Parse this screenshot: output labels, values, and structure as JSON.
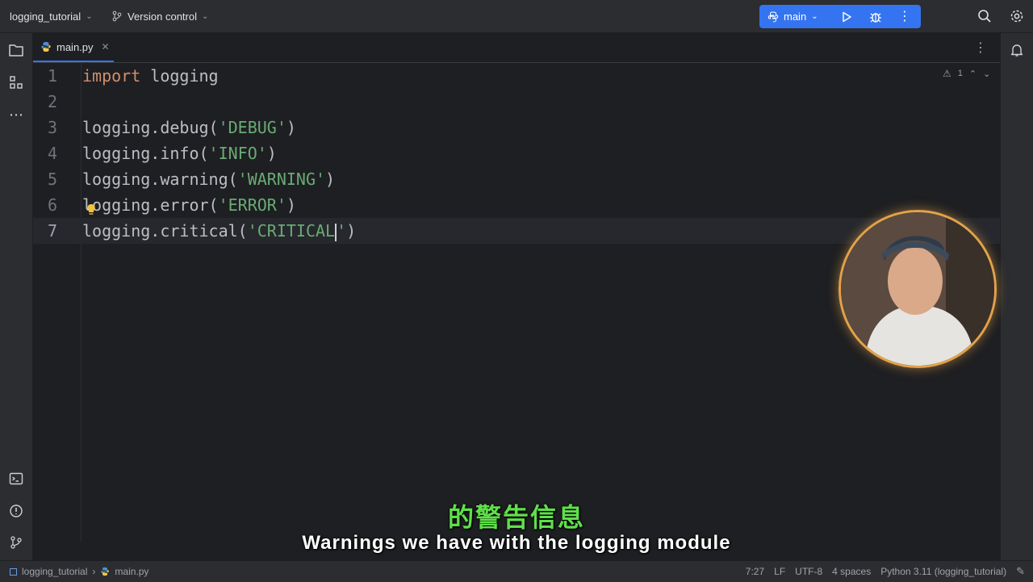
{
  "titlebar": {
    "project_name": "logging_tutorial",
    "vcs_label": "Version control",
    "run_config": "main"
  },
  "tabs": [
    {
      "label": "main.py",
      "active": true
    }
  ],
  "editor": {
    "lines": [
      {
        "num": "1",
        "tokens": [
          {
            "t": "import",
            "c": "kw"
          },
          {
            "t": " logging",
            "c": ""
          }
        ]
      },
      {
        "num": "2",
        "tokens": []
      },
      {
        "num": "3",
        "tokens": [
          {
            "t": "logging.debug(",
            "c": ""
          },
          {
            "t": "'DEBUG'",
            "c": "str"
          },
          {
            "t": ")",
            "c": ""
          }
        ]
      },
      {
        "num": "4",
        "tokens": [
          {
            "t": "logging.info(",
            "c": ""
          },
          {
            "t": "'INFO'",
            "c": "str"
          },
          {
            "t": ")",
            "c": ""
          }
        ]
      },
      {
        "num": "5",
        "tokens": [
          {
            "t": "logging.warning(",
            "c": ""
          },
          {
            "t": "'WARNING'",
            "c": "str"
          },
          {
            "t": ")",
            "c": ""
          }
        ]
      },
      {
        "num": "6",
        "tokens": [
          {
            "t": "logging.error(",
            "c": ""
          },
          {
            "t": "'ERROR'",
            "c": "str"
          },
          {
            "t": ")",
            "c": ""
          }
        ]
      },
      {
        "num": "7",
        "tokens": [
          {
            "t": "logging.critical(",
            "c": ""
          },
          {
            "t": "'CRITICAL",
            "c": "str"
          },
          {
            "t": "|",
            "c": "caret"
          },
          {
            "t": "'",
            "c": "str"
          },
          {
            "t": ")",
            "c": ""
          }
        ],
        "current": true
      }
    ],
    "warning_count": "1"
  },
  "subtitles": {
    "chinese": "的警告信息",
    "english": "Warnings we have with the logging module"
  },
  "statusbar": {
    "breadcrumb_project": "logging_tutorial",
    "breadcrumb_file": "main.py",
    "cursor_position": "7:27",
    "line_separator": "LF",
    "encoding": "UTF-8",
    "indent": "4 spaces",
    "interpreter": "Python 3.11 (logging_tutorial)"
  },
  "colors": {
    "accent": "#3574f0",
    "keyword": "#cf8e6d",
    "string": "#6aab73",
    "subtitle_cn": "#5fe04a",
    "webcam_ring": "#e3a24a"
  }
}
